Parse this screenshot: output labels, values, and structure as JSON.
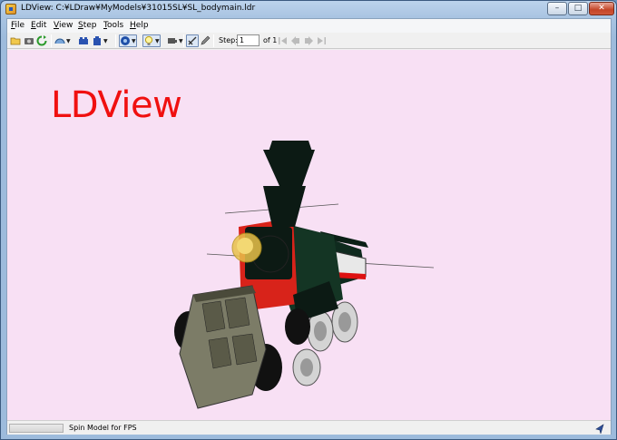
{
  "window": {
    "title": "LDView: C:¥LDraw¥MyModels¥31015SL¥SL_bodymain.ldr",
    "controls": {
      "minimize": "–",
      "maximize": "□",
      "close": "✕"
    }
  },
  "menubar": [
    "File",
    "Edit",
    "View",
    "Step",
    "Tools",
    "Help"
  ],
  "toolbar": {
    "icons": [
      "open-file-icon",
      "screenshot-icon",
      "reload-icon",
      "view-angle-icon",
      "parts-list-icon",
      "export-icon",
      "wireframe-icon",
      "lighting-icon",
      "view-mode-icon",
      "top-view-icon",
      "edit-icon"
    ],
    "step_label": "Step:",
    "step_value": "1",
    "step_of": "of 1"
  },
  "viewport": {
    "watermark": "LDView",
    "background_color": "#f8e0f4"
  },
  "status": {
    "text": "Spin Model for FPS"
  }
}
